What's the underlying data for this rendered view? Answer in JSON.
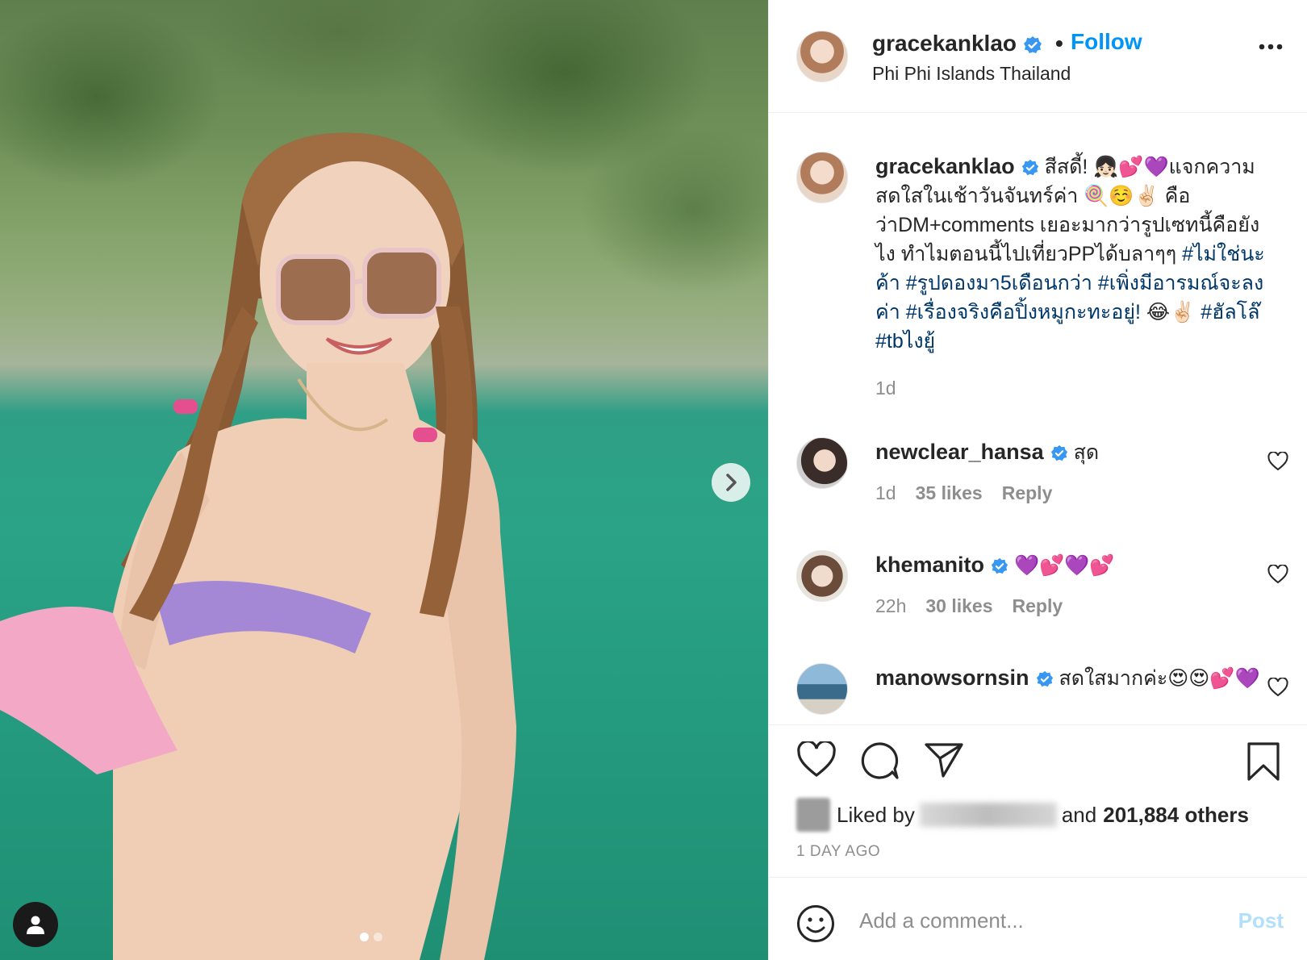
{
  "post": {
    "username": "gracekanklao",
    "follow_label": "Follow",
    "separator": "•",
    "location": "Phi Phi Islands Thailand"
  },
  "caption": {
    "username": "gracekanklao",
    "text": "สีสดี้! 👧🏻💕💜แจกความสดใสในเช้าวันจันทร์ค่า 🍭☺️✌🏻 คือว่าDM+comments เยอะมากว่ารูปเซทนี้คือยังไง ทำไมตอนนี้ไปเที่ยวPPได้บลาๆๆ",
    "hashtags": "#ไม่ใช่นะค้า #รูปดองมา5เดือนกว่า #เพิ่งมีอารมณ์จะลงค่า #เรื่องจริงคือปิ้งหมูกะทะอยู่! ",
    "tail_emoji": "😂✌🏻",
    "tail_hashtags": "#ฮัลโล๊ #tbไงยู้",
    "time": "1d"
  },
  "comments": [
    {
      "username": "newclear_hansa",
      "text": "สุด",
      "time": "1d",
      "likes": "35 likes",
      "reply": "Reply"
    },
    {
      "username": "khemanito",
      "text": "💜💕💜💕",
      "time": "22h",
      "likes": "30 likes",
      "reply": "Reply"
    },
    {
      "username": "manowsornsin",
      "text": "สดใสมากค่ะ😍😍💕💜",
      "time": "",
      "likes": "",
      "reply": ""
    }
  ],
  "likes": {
    "prefix": "Liked by",
    "suffix_word": "and",
    "count": "201,884 others"
  },
  "timestamp": "1 DAY AGO",
  "comment_box": {
    "placeholder": "Add a comment...",
    "post_label": "Post"
  },
  "colors": {
    "link_blue": "#0095f6",
    "hashtag_blue": "#00376b",
    "muted": "#8e8e8e",
    "post_disabled": "#b2dffc"
  },
  "icons": {
    "verified": "verified-badge-icon",
    "more": "more-options-icon",
    "next": "chevron-right-icon",
    "tag": "user-tag-icon",
    "like": "heart-icon",
    "comment": "comment-bubble-icon",
    "share": "paper-plane-icon",
    "save": "bookmark-icon",
    "emoji": "emoji-icon"
  }
}
